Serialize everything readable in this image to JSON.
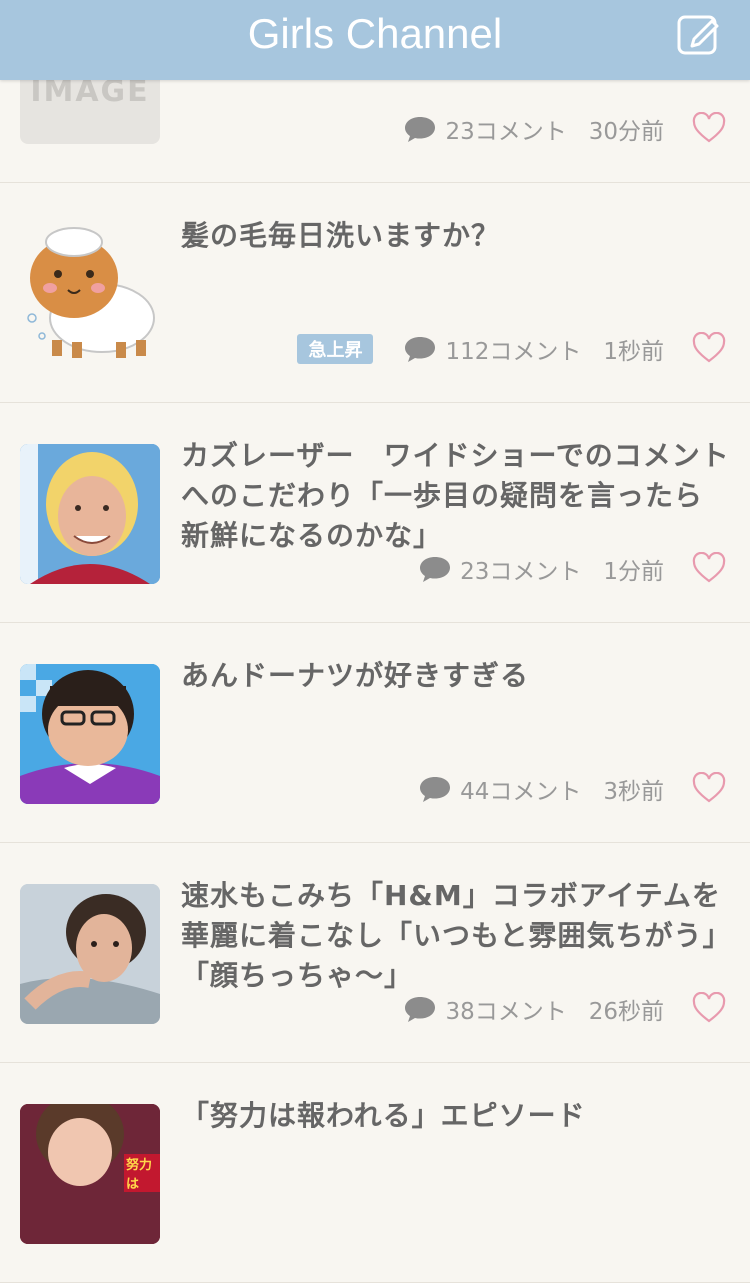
{
  "header": {
    "title": "Girls Channel",
    "compose_icon": "compose-icon"
  },
  "colors": {
    "header_bg": "#a7c6de",
    "heart": "#e89aae",
    "badge_bg": "#a7c6de"
  },
  "topics": [
    {
      "title": "",
      "thumb_text": "IMAGE",
      "comments": "23コメント",
      "time": "30分前",
      "badge": ""
    },
    {
      "title": "髪の毛毎日洗いますか？",
      "comments": "112コメント",
      "time": "1秒前",
      "badge": "急上昇"
    },
    {
      "title": "カズレーザー　ワイドショーでのコメントへのこだわり「一歩目の疑問を言ったら新鮮になるのかな」",
      "comments": "23コメント",
      "time": "1分前",
      "badge": ""
    },
    {
      "title": "あんドーナツが好きすぎる",
      "comments": "44コメント",
      "time": "3秒前",
      "badge": ""
    },
    {
      "title": "速水もこみち「H&M」コラボアイテムを華麗に着こなし「いつもと雰囲気ちがう」「顔ちっちゃ〜」",
      "comments": "38コメント",
      "time": "26秒前",
      "badge": ""
    },
    {
      "title": "「努力は報われる」エピソード",
      "comments": "",
      "time": "",
      "badge": "",
      "thumb_text": "努力は"
    }
  ]
}
